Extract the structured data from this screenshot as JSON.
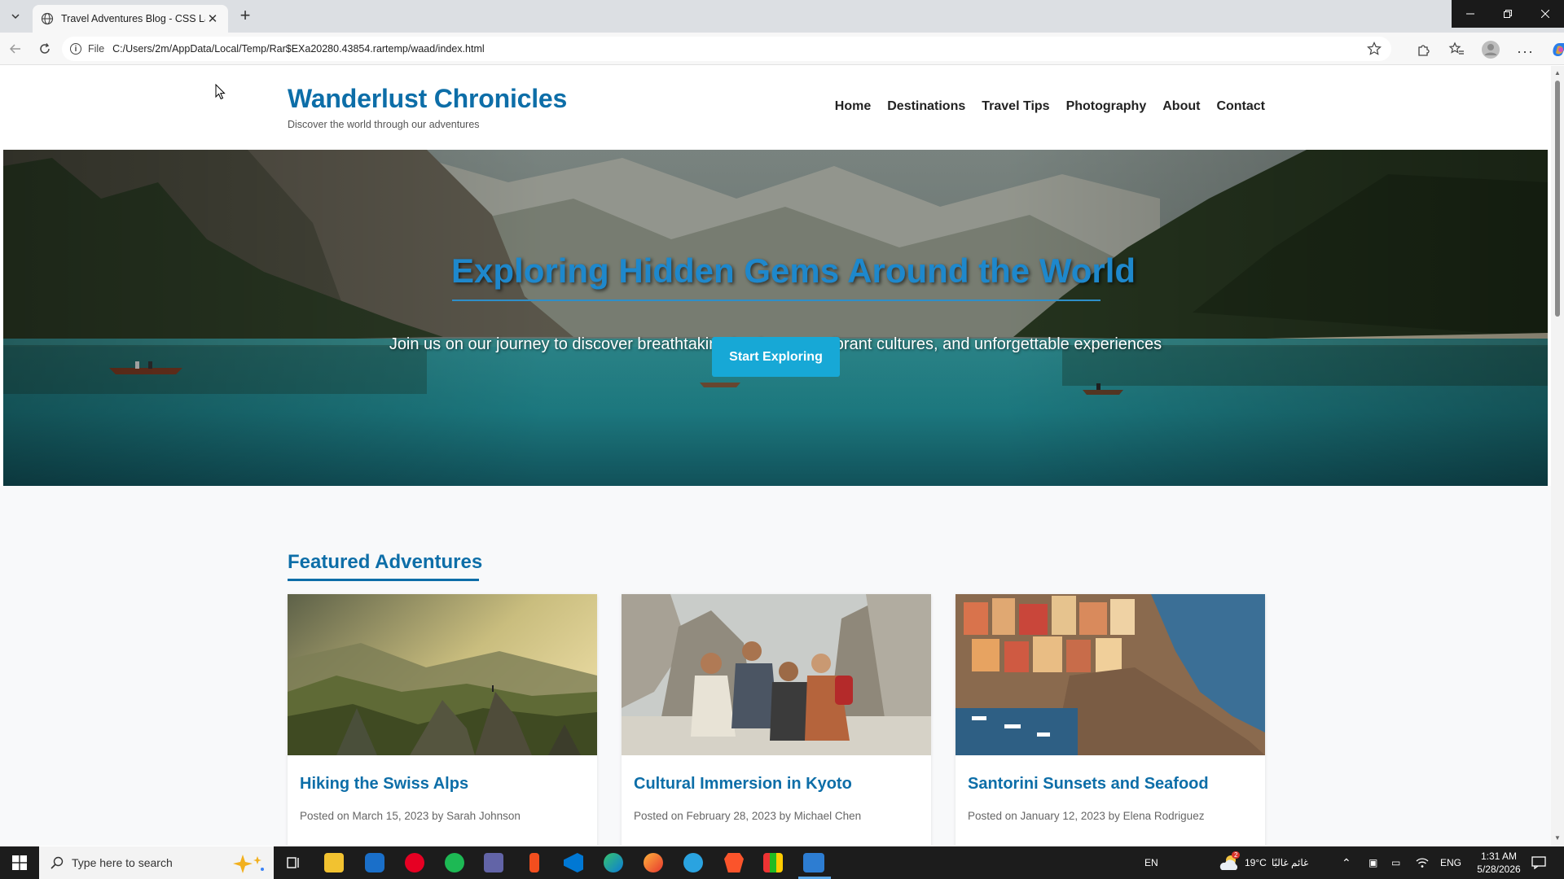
{
  "browser": {
    "tab_title": "Travel Adventures Blog - CSS Lab",
    "url_label": "File",
    "url": "C:/Users/2m/AppData/Local/Temp/Rar$EXa20280.43854.rartemp/waad/index.html"
  },
  "site": {
    "title": "Wanderlust Chronicles",
    "tagline": "Discover the world through our adventures",
    "nav": [
      "Home",
      "Destinations",
      "Travel Tips",
      "Photography",
      "About",
      "Contact"
    ]
  },
  "hero": {
    "title": "Exploring Hidden Gems Around the World",
    "subtitle": "Join us on our journey to discover breathtaking landscapes, vibrant cultures, and unforgettable experiences",
    "button": "Start Exploring"
  },
  "featured": {
    "heading": "Featured Adventures",
    "cards": [
      {
        "title": "Hiking the Swiss Alps",
        "meta": "Posted on March 15, 2023 by Sarah Johnson"
      },
      {
        "title": "Cultural Immersion in Kyoto",
        "meta": "Posted on February 28, 2023 by Michael Chen"
      },
      {
        "title": "Santorini Sunsets and Seafood",
        "meta": "Posted on January 12, 2023 by Elena Rodriguez"
      }
    ]
  },
  "taskbar": {
    "search_placeholder": "Type here to search",
    "input_lang": "EN",
    "weather_temp": "19°C",
    "weather_text": "غائم غالبًا",
    "weather_badge": "2",
    "keyboard": "ENG",
    "time": "1:31 AM",
    "date": "5/28/2026"
  },
  "colors": {
    "brand": "#0d6ea8",
    "accent_button": "#17a8d6",
    "hero_title": "#1e88cc"
  }
}
